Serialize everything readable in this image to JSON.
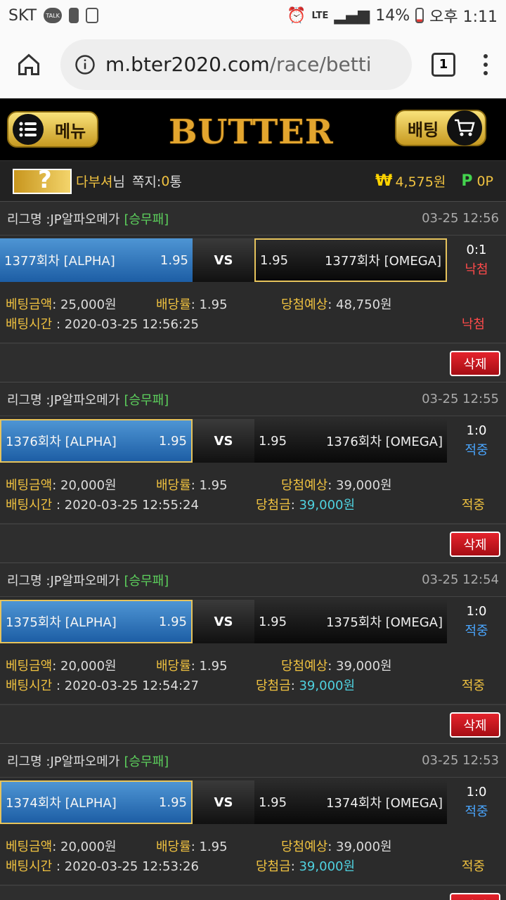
{
  "status_bar": {
    "carrier": "SKT",
    "talk_label": "TALK",
    "network": "LTE",
    "battery": "14%",
    "time": "오후 1:11"
  },
  "browser": {
    "url_domain": "m.bter2020.com",
    "url_path": "/race/betti",
    "tab_count": "1"
  },
  "site": {
    "menu_label": "메뉴",
    "logo": "BUTTER",
    "betting_label": "배팅"
  },
  "user": {
    "name": "다부셔",
    "honorific": "님",
    "note_label": "쪽지:",
    "note_count": "0",
    "note_unit": "통",
    "won_symbol": "₩",
    "money": "4,575원",
    "point_symbol": "P",
    "points": "0P"
  },
  "labels": {
    "league_prefix": "리그명 : ",
    "vs": "VS",
    "bet_amount": "베팅금액",
    "odds": "배당률",
    "expected_win": "당첨예상",
    "bet_time": "배팅시간",
    "win_amount": "당첨금",
    "delete": "삭제"
  },
  "bets": [
    {
      "league": "JP알파오메가",
      "type": "[승무패]",
      "date": "03-25 12:56",
      "home": "1377회차 [ALPHA]",
      "home_odds": "1.95",
      "away_odds": "1.95",
      "away": "1377회차 [OMEGA]",
      "score": "0:1",
      "match_result": "낙첨",
      "amount": ": 25,000원",
      "rate": ": 1.95",
      "expected": ": 48,750원",
      "time": " : 2020-03-25 12:56:25",
      "won_amount": "",
      "status": "낙첨"
    },
    {
      "league": "JP알파오메가",
      "type": "[승무패]",
      "date": "03-25 12:55",
      "home": "1376회차 [ALPHA]",
      "home_odds": "1.95",
      "away_odds": "1.95",
      "away": "1376회차 [OMEGA]",
      "score": "1:0",
      "match_result": "적중",
      "amount": ": 20,000원",
      "rate": ": 1.95",
      "expected": ": 39,000원",
      "time": " : 2020-03-25 12:55:24",
      "won_amount": "39,000원",
      "status": "적중"
    },
    {
      "league": "JP알파오메가",
      "type": "[승무패]",
      "date": "03-25 12:54",
      "home": "1375회차 [ALPHA]",
      "home_odds": "1.95",
      "away_odds": "1.95",
      "away": "1375회차 [OMEGA]",
      "score": "1:0",
      "match_result": "적중",
      "amount": ": 20,000원",
      "rate": ": 1.95",
      "expected": ": 39,000원",
      "time": " : 2020-03-25 12:54:27",
      "won_amount": "39,000원",
      "status": "적중"
    },
    {
      "league": "JP알파오메가",
      "type": "[승무패]",
      "date": "03-25 12:53",
      "home": "1374회차 [ALPHA]",
      "home_odds": "1.95",
      "away_odds": "1.95",
      "away": "1374회차 [OMEGA]",
      "score": "1:0",
      "match_result": "적중",
      "amount": ": 20,000원",
      "rate": ": 1.95",
      "expected": ": 39,000원",
      "time": " : 2020-03-25 12:53:26",
      "won_amount": "39,000원",
      "status": "적중"
    }
  ]
}
